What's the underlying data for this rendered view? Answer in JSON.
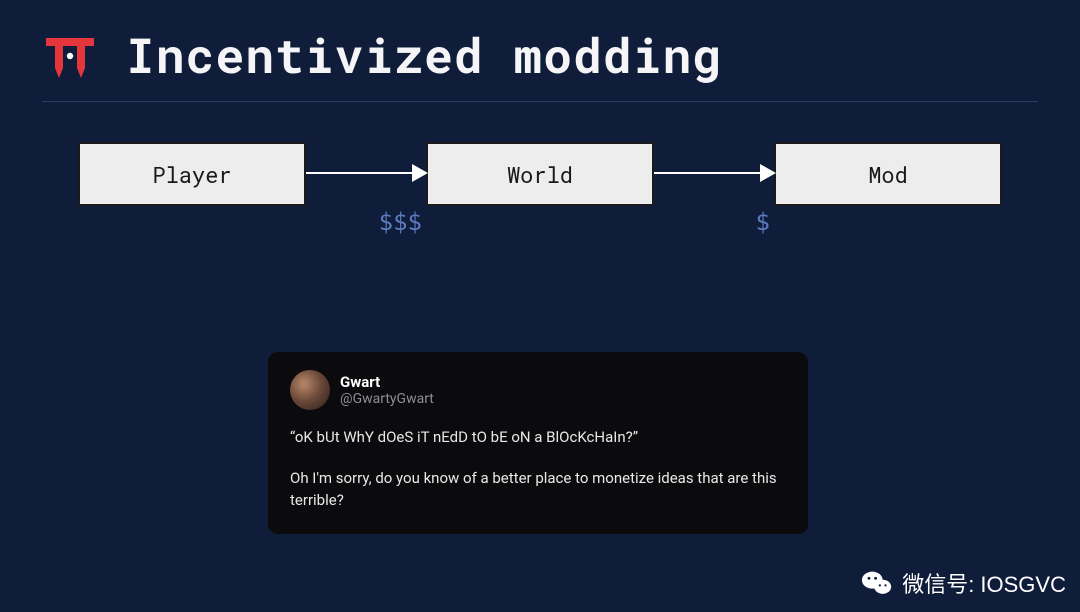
{
  "title": "Incentivized modding",
  "diagram": {
    "nodes": [
      "Player",
      "World",
      "Mod"
    ],
    "arrows": [
      {
        "label": "$$$"
      },
      {
        "label": "$"
      }
    ]
  },
  "tweet": {
    "display_name": "Gwart",
    "handle": "@GwartyGwart",
    "line1": "“oK bUt WhY dOeS iT nEdD tO bE oN a BlOcKcHaIn?”",
    "line2": "Oh I'm sorry, do you know of a better place to monetize ideas that are this terrible?"
  },
  "watermark": {
    "label": "微信号: IOSGVC"
  },
  "chart_data": {
    "type": "flow-diagram",
    "nodes": [
      "Player",
      "World",
      "Mod"
    ],
    "edges": [
      {
        "from": "Player",
        "to": "World",
        "label": "$$$"
      },
      {
        "from": "World",
        "to": "Mod",
        "label": "$"
      }
    ],
    "title": "Incentivized modding"
  }
}
